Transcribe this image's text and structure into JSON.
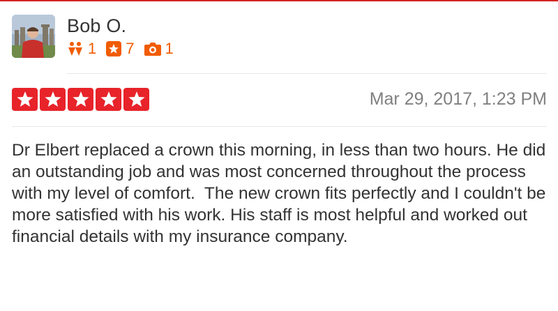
{
  "user": {
    "name": "Bob O.",
    "friends_count": "1",
    "reviews_count": "7",
    "photos_count": "1"
  },
  "review": {
    "rating": 5,
    "rating_max": 5,
    "date": "Mar 29, 2017, 1:23 PM",
    "text": "Dr Elbert replaced a crown this morning, in less than two hours. He did an outstanding job and was most concerned throughout the process with my level of comfort.  The new crown fits perfectly and I couldn't be more satisfied with his work. His staff is most helpful and worked out financial details with my insurance company."
  },
  "colors": {
    "star_red": "#e8232a",
    "stat_orange": "#f15c00",
    "text_dark": "#333333",
    "date_gray": "#808080"
  },
  "icons": {
    "friends": "friends-icon",
    "reviews": "review-star-icon",
    "photos": "camera-icon",
    "rating": "star-icon"
  }
}
